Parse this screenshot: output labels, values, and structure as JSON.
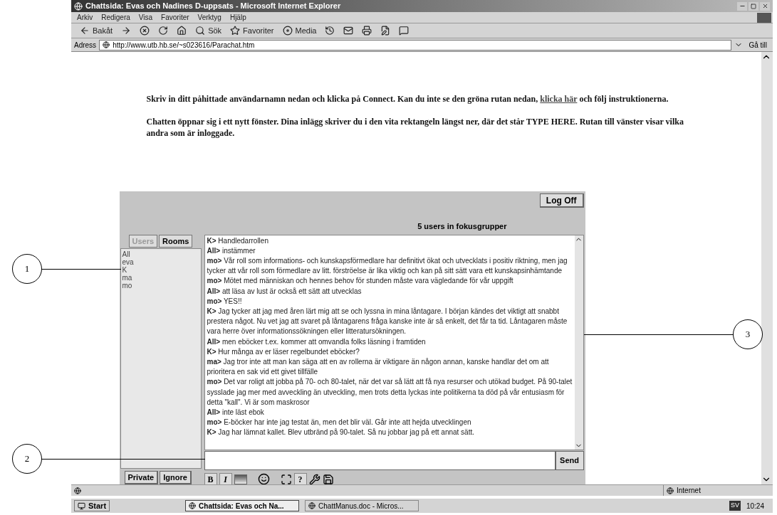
{
  "window": {
    "title": "Chattsida: Evas och Nadines D-uppsats - Microsoft Internet Explorer"
  },
  "menu": [
    "Arkiv",
    "Redigera",
    "Visa",
    "Favoriter",
    "Verktyg",
    "Hjälp"
  ],
  "toolbar": [
    {
      "kind": "back",
      "label": "Bakåt"
    },
    {
      "kind": "forward"
    },
    {
      "kind": "stop"
    },
    {
      "kind": "refresh"
    },
    {
      "kind": "home"
    },
    {
      "kind": "search",
      "label": "Sök"
    },
    {
      "kind": "favorites",
      "label": "Favoriter"
    },
    {
      "kind": "media",
      "label": "Media"
    },
    {
      "kind": "history"
    },
    {
      "kind": "mail"
    },
    {
      "kind": "print"
    },
    {
      "kind": "edit"
    },
    {
      "kind": "discuss"
    }
  ],
  "address": {
    "label": "Adress",
    "value": "http://www.utb.hb.se/~s023616/Parachat.htm",
    "go": "Gå till"
  },
  "instructions": [
    {
      "before": "Skriv in ditt påhittade användarnamn nedan och klicka på Connect. Kan du inte se den gröna rutan nedan, ",
      "link": "klicka här",
      "after": " och följ instruktionerna."
    },
    {
      "before": "Chatten öppnar sig i ett nytt fönster. Dina inlägg skriver du i den vita rektangeln längst ner, där det står TYPE HERE. Rutan till vänster visar vilka andra som är inloggade."
    }
  ],
  "chat": {
    "log_off": "Log Off",
    "status": "5 users in fokusgrupper",
    "tabs": [
      {
        "label": "Users",
        "disabled": true
      },
      {
        "label": "Rooms",
        "disabled": false
      }
    ],
    "users": [
      "All",
      "eva",
      "K",
      "ma",
      "mo"
    ],
    "messages": [
      {
        "sender": "K>",
        "text": "Handledarrollen"
      },
      {
        "sender": "All>",
        "text": "instämmer"
      },
      {
        "sender": "mo>",
        "text": "Vår roll som informations- och kunskapsförmedlare har definitivt ökat och utvecklats i positiv riktning, men jag tycker att vår roll som förmedlare av litt. förströelse är lika viktig och kan på sitt sätt vara ett kunskapsinhämtande"
      },
      {
        "sender": "mo>",
        "text": "Mötet med människan och hennes behov för stunden måste vara vägledande för vår uppgift"
      },
      {
        "sender": "All>",
        "text": "att läsa av lust är också ett sätt att utvecklas"
      },
      {
        "sender": "mo>",
        "text": "YES!!"
      },
      {
        "sender": "K>",
        "text": "Jag tycker att jag med åren lärt mig att se och lyssna in mina låntagare. I början kändes det viktigt att snabbt prestera något. Nu vet jag att svaret på låntagarens fråga kanske inte är så enkelt, det får ta tid. Låntagaren måste vara herre över informationssökningen eller litteratursökningen."
      },
      {
        "sender": "All>",
        "text": "men eböcker t.ex. kommer att omvandla folks läsning i framtiden"
      },
      {
        "sender": "K>",
        "text": "Hur många av er läser regelbundet eböcker?"
      },
      {
        "sender": "ma>",
        "text": "Jag tror inte att man kan säga att en av rollerna är viktigare än någon annan, kanske handlar det om att prioritera en sak vid ett givet tillfälle"
      },
      {
        "sender": "mo>",
        "text": "Det var roligt att jobba på 70- och 80-talet, när det var så lätt att få nya resurser och utökad budget. På 90-talet sysslade jag mer med avveckling än utveckling, men trots detta lyckas inte politikerna ta död på vår entusiasm för detta \"kall\". Vi är som maskrosor"
      },
      {
        "sender": "All>",
        "text": "inte läst ebok"
      },
      {
        "sender": "mo>",
        "text": "E-böcker har inte jag testat än, men det blir väl. Går inte att hejda utvecklingen"
      },
      {
        "sender": "K>",
        "text": "Jag har lämnat kallet. Blev utbränd på 90-talet. Så nu jobbar jag på ett annat sätt."
      }
    ],
    "send": "Send",
    "buttons": [
      "Private",
      "Ignore"
    ],
    "format_tools": [
      {
        "kind": "text",
        "label": "B"
      },
      {
        "kind": "italic",
        "label": "I"
      },
      {
        "kind": "color"
      },
      {
        "kind": "smiley"
      },
      {
        "kind": "expand"
      },
      {
        "kind": "text",
        "label": "?"
      },
      {
        "kind": "tools"
      },
      {
        "kind": "save"
      }
    ]
  },
  "status_bar": {
    "zone": "Internet"
  },
  "taskbar": {
    "start": "Start",
    "tasks": [
      {
        "label": "Chattsida: Evas och Na...",
        "selected": true
      },
      {
        "label": "ChattManus.doc - Micros...",
        "selected": false
      }
    ],
    "language": "SV",
    "clock": "10:24"
  },
  "callouts": [
    {
      "label": "1"
    },
    {
      "label": "2"
    },
    {
      "label": "3"
    }
  ]
}
